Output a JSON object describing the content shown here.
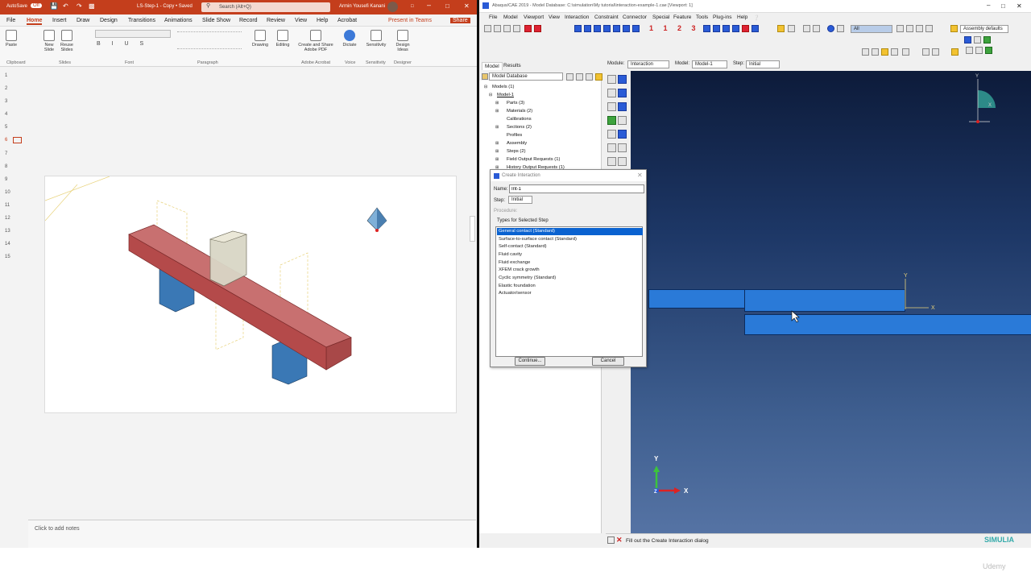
{
  "ppt": {
    "autosave": "AutoSave",
    "autosave_state": "Off",
    "file_title": "LS-Step-1 - Copy • Saved",
    "search_placeholder": "Search (Alt+Q)",
    "user": "Armin Yousefi Kanani",
    "menu": [
      "File",
      "Home",
      "Insert",
      "Draw",
      "Design",
      "Transitions",
      "Animations",
      "Slide Show",
      "Record",
      "Review",
      "View",
      "Help",
      "Acrobat"
    ],
    "present_in_teams": "Present in Teams",
    "share": "Share",
    "ribbon": {
      "paste": "Paste",
      "new_slide": "New Slide",
      "reuse_slides": "Reuse Slides",
      "drawing": "Drawing",
      "editing": "Editing",
      "create_share_pdf": "Create and Share Adobe PDF",
      "dictate": "Dictate",
      "sensitivity": "Sensitivity",
      "design_ideas": "Design Ideas",
      "groups": [
        "Clipboard",
        "Slides",
        "Font",
        "Paragraph",
        "Adobe Acrobat",
        "Voice",
        "Sensitivity",
        "Designer"
      ]
    },
    "slide_numbers": [
      "1",
      "2",
      "3",
      "4",
      "5",
      "6",
      "7",
      "8",
      "9",
      "10",
      "11",
      "12",
      "13",
      "14",
      "15"
    ],
    "active_slide": "6",
    "notes_placeholder": "Click to add notes"
  },
  "abaqus": {
    "title": "Abaqus/CAE 2019 - Model Database: C:\\simulation\\My tutorial\\interaction-example-1.cae [Viewport: 1]",
    "menu": [
      "File",
      "Model",
      "Viewport",
      "View",
      "Interaction",
      "Constraint",
      "Connector",
      "Special",
      "Feature",
      "Tools",
      "Plug-ins",
      "Help"
    ],
    "assembly_defaults": "Assembly defaults",
    "all_filter": "All",
    "tabs": [
      "Model",
      "Results"
    ],
    "db_select": "Model Database",
    "module_label": "Module:",
    "module_value": "Interaction",
    "model_label": "Model:",
    "model_value": "Model-1",
    "step_label": "Step:",
    "step_value": "Initial",
    "tree": [
      "Models (1)",
      "Model-1",
      "Parts (3)",
      "Materials (2)",
      "Calibrations",
      "Sections (2)",
      "Profiles",
      "Assembly",
      "Steps (2)",
      "Field Output Requests (1)",
      "History Output Requests (1)"
    ],
    "status_text": "Fill out the Create Interaction dialog",
    "simulia": "SIMULIA",
    "triad_x": "X",
    "triad_y": "Y",
    "triad_z": "Z",
    "corner_x": "X",
    "corner_y": "Y",
    "udemy": "Udemy"
  },
  "dialog": {
    "title": "Create Interaction",
    "name_label": "Name:",
    "name_value": "Int-1",
    "step_label": "Step:",
    "step_value": "Initial",
    "procedure_label": "Procedure:",
    "types_label": "Types for Selected Step",
    "types": [
      "General contact (Standard)",
      "Surface-to-surface contact (Standard)",
      "Self-contact (Standard)",
      "Fluid cavity",
      "Fluid exchange",
      "XFEM crack growth",
      "Cyclic symmetry (Standard)",
      "Elastic foundation",
      "Actuator/sensor"
    ],
    "selected_index": 0,
    "continue_label": "Continue...",
    "cancel_label": "Cancel"
  },
  "colors": {
    "ppt_brand": "#c43e1c",
    "selection": "#0a62d0",
    "part_blue": "#2a7ad8",
    "beam_red": "#b44a4a",
    "column_blue": "#3a78b5"
  }
}
